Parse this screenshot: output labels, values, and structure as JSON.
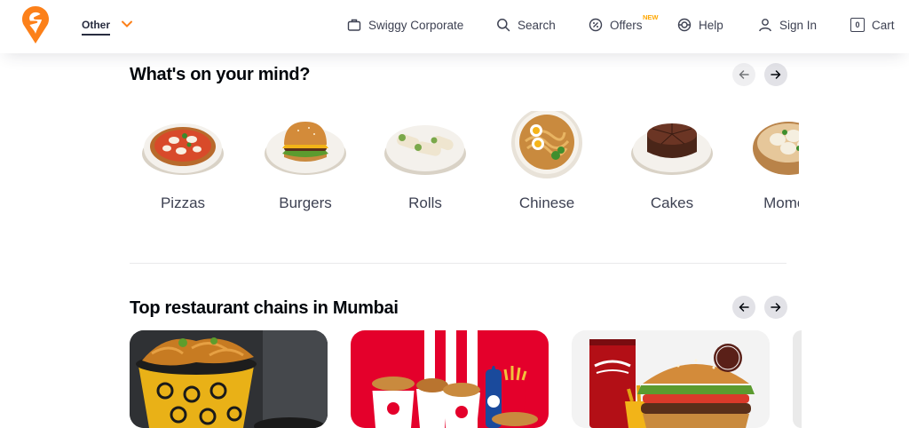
{
  "header": {
    "location_label": "Other",
    "nav": {
      "corporate": "Swiggy Corporate",
      "search": "Search",
      "offers": "Offers",
      "offers_badge": "NEW",
      "help": "Help",
      "signin": "Sign In",
      "cart": "Cart",
      "cart_count": "0"
    }
  },
  "mind_section": {
    "title": "What's on your mind?",
    "items": [
      {
        "label": "Pizzas"
      },
      {
        "label": "Burgers"
      },
      {
        "label": "Rolls"
      },
      {
        "label": "Chinese"
      },
      {
        "label": "Cakes"
      },
      {
        "label": "Momos"
      }
    ]
  },
  "chains_section": {
    "title": "Top restaurant chains in Mumbai"
  },
  "colors": {
    "brand": "#fc8019",
    "badge": "#ffa700",
    "heading": "#02060c",
    "text": "#3d4152",
    "kfc_red": "#e4002b"
  }
}
